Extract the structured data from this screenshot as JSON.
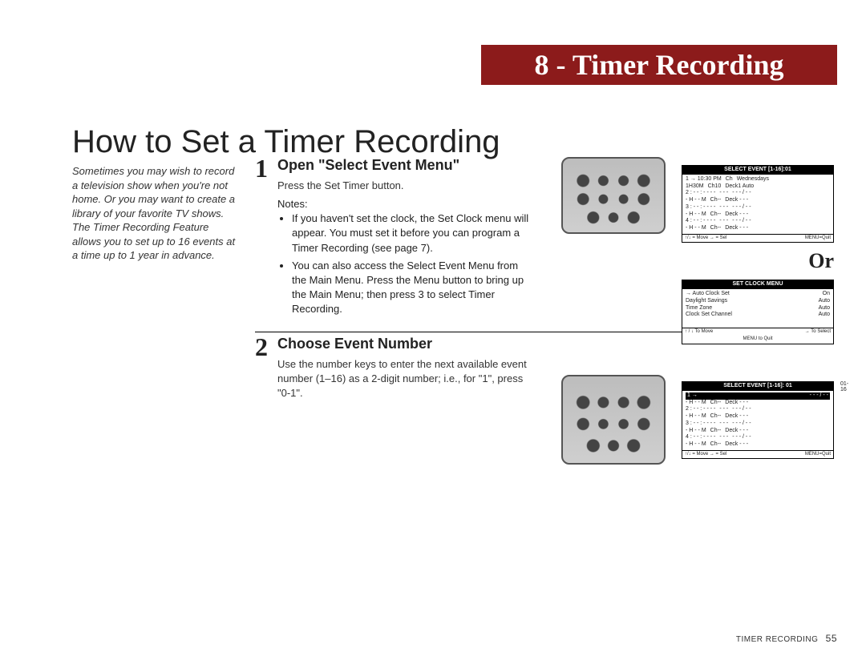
{
  "chapter": {
    "label": "8 - Timer Recording"
  },
  "title": "How to Set a Timer Recording",
  "intro": "Sometimes you may wish to record a television show when you're not home. Or you may want to create a library of your favorite TV shows. The Timer Recording Feature allows you to set up to 16 events at a time up to 1 year in advance.",
  "steps": {
    "s1": {
      "num": "1",
      "title": "Open \"Select Event Menu\"",
      "text": "Press the Set Timer button.",
      "notes_label": "Notes:",
      "note1": "If you haven't set the clock, the Set Clock menu will appear. You must set it before you can program a Timer Recording (see page 7).",
      "note2": "You can also access the Select Event Menu from the Main Menu.  Press the Menu button to bring up the Main Menu; then press 3 to select Timer Recording."
    },
    "s2": {
      "num": "2",
      "title": "Choose Event Number",
      "text": "Use the number keys to enter the next available event number (1–16) as a 2-digit number; i.e., for \"1\", press \"0-1\"."
    }
  },
  "or_label": "Or",
  "screen1": {
    "header": "SELECT EVENT [1-16]:01",
    "r1a": "1 → 10:30 PM",
    "r1b": "Ch",
    "r1c": "Wednesdays",
    "r1d": "1H30M",
    "r1e": "Ch10",
    "r1f": "Deck1 Auto",
    "r2a": "2 : - - : - - - -",
    "r2b": "- - -",
    "r2c": "- - - / - -",
    "r2d": "- H - - M",
    "r2e": "Ch--",
    "r2f": "Deck - - -",
    "r3a": "3 : - - : - - - -",
    "r3b": "- - -",
    "r3c": "- - - / - -",
    "r3d": "- H - - M",
    "r3e": "Ch--",
    "r3f": "Deck - - -",
    "r4a": "4 : - - : - - - -",
    "r4b": "- - -",
    "r4c": "- - - / - -",
    "r4d": "- H - - M",
    "r4e": "Ch--",
    "r4f": "Deck - - -",
    "foot_l": "↑/↓ = Move   → = Sel",
    "foot_r": "MENU=Quit"
  },
  "screen2": {
    "header": "SET CLOCK MENU",
    "r1a": "→ Auto Clock Set",
    "r1b": "On",
    "r2a": "Daylight Savings",
    "r2b": "Auto",
    "r3a": "Time Zone",
    "r3b": "Auto",
    "r4a": "Clock Set Channel",
    "r4b": "Auto",
    "foot_l": "↑ / ↓   To Move",
    "foot_r": "→   To Select",
    "foot2": "MENU to Quit"
  },
  "screen3": {
    "header": "SELECT EVENT [1-16]: 01",
    "date": "01-16",
    "r1a": "1 →",
    "r1b": "",
    "r1c": "- - - / - -",
    "r1d": "- H - - M",
    "r1e": "Ch--",
    "r1f": "Deck - - -",
    "r2a": "2 : - - : - - - -",
    "r2b": "- - -",
    "r2c": "- - - / - -",
    "r2d": "- H - - M",
    "r2e": "Ch--",
    "r2f": "Deck - - -",
    "r3a": "3 : - - : - - - -",
    "r3b": "- - -",
    "r3c": "- - - / - -",
    "r3d": "- H - - M",
    "r3e": "Ch--",
    "r3f": "Deck - - -",
    "r4a": "4 : - - : - - - -",
    "r4b": "- - -",
    "r4c": "- - - / - -",
    "r4d": "- H - - M",
    "r4e": "Ch--",
    "r4f": "Deck - - -",
    "foot_l": "↑/↓ = Move   → = Sel",
    "foot_r": "MENU=Quit"
  },
  "footer": {
    "label": "TIMER RECORDING",
    "page": "55"
  }
}
